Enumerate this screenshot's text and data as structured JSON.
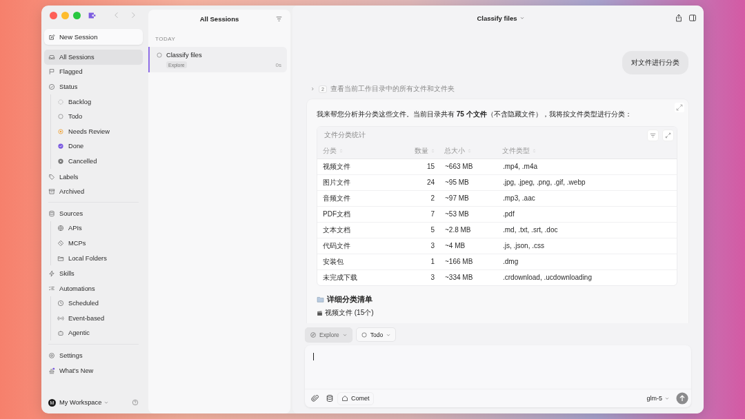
{
  "sidebar": {
    "new_session": "New Session",
    "groups": [
      {
        "items": [
          {
            "label": "All Sessions",
            "selected": true
          },
          {
            "label": "Flagged",
            "selected": false
          },
          {
            "label": "Status",
            "selected": false,
            "children": [
              {
                "label": "Backlog",
                "kind": "backlog",
                "selected": false
              },
              {
                "label": "Todo",
                "kind": "todo",
                "selected": false
              },
              {
                "label": "Needs Review",
                "kind": "review",
                "selected": false
              },
              {
                "label": "Done",
                "kind": "done",
                "selected": false
              },
              {
                "label": "Cancelled",
                "kind": "cancelled",
                "selected": false
              }
            ]
          },
          {
            "label": "Labels",
            "selected": false
          },
          {
            "label": "Archived",
            "selected": false
          }
        ]
      },
      {
        "items": [
          {
            "label": "Sources",
            "selected": false,
            "children": [
              {
                "label": "APIs",
                "selected": false
              },
              {
                "label": "MCPs",
                "selected": false
              },
              {
                "label": "Local Folders",
                "selected": false
              }
            ]
          },
          {
            "label": "Skills",
            "selected": false
          },
          {
            "label": "Automations",
            "selected": false,
            "children": [
              {
                "label": "Scheduled",
                "selected": false
              },
              {
                "label": "Event-based",
                "selected": false
              },
              {
                "label": "Agentic",
                "selected": false
              }
            ]
          }
        ]
      },
      {
        "items": [
          {
            "label": "Settings",
            "selected": false
          },
          {
            "label": "What's New",
            "selected": false
          }
        ]
      }
    ],
    "workspace": {
      "avatar": "M",
      "name": "My Workspace"
    }
  },
  "session_list": {
    "title": "All Sessions",
    "groups": [
      {
        "heading": "TODAY",
        "sessions": [
          {
            "title": "Classify files",
            "tag": "Explore",
            "time": "0s",
            "selected": true
          }
        ]
      }
    ]
  },
  "chat": {
    "title": "Classify files",
    "user_message": "对文件进行分类",
    "step": {
      "count": "2",
      "text": "查看当前工作目录中的所有文件和文件夹"
    },
    "answer": {
      "intro": "我来帮您分析并分类这些文件。当前目录共有 **75 个文件**（不含隐藏文件），我将按文件类型进行分类：",
      "table": {
        "title": "文件分类统计",
        "columns": [
          "分类",
          "数量",
          "总大小",
          "文件类型"
        ],
        "rows": [
          [
            "视频文件",
            "15",
            "~663 MB",
            ".mp4, .m4a"
          ],
          [
            "图片文件",
            "24",
            "~95 MB",
            ".jpg, .jpeg, .png, .gif, .webp"
          ],
          [
            "音频文件",
            "2",
            "~97 MB",
            ".mp3, .aac"
          ],
          [
            "PDF文档",
            "7",
            "~53 MB",
            ".pdf"
          ],
          [
            "文本文档",
            "5",
            "~2.8 MB",
            ".md, .txt, .srt, .doc"
          ],
          [
            "代码文件",
            "3",
            "~4 MB",
            ".js, .json, .css"
          ],
          [
            "安装包",
            "1",
            "~166 MB",
            ".dmg"
          ],
          [
            "未完成下载",
            "3",
            "~334 MB",
            ".crdownload, .ucdownloading"
          ]
        ]
      },
      "heading": "详细分类清单",
      "subheading": "视频文件 (15个)"
    }
  },
  "composer": {
    "chips": [
      {
        "label": "Explore",
        "selected": true
      },
      {
        "label": "Todo",
        "selected": false
      }
    ],
    "source": "Comet",
    "model": "glm-5"
  }
}
